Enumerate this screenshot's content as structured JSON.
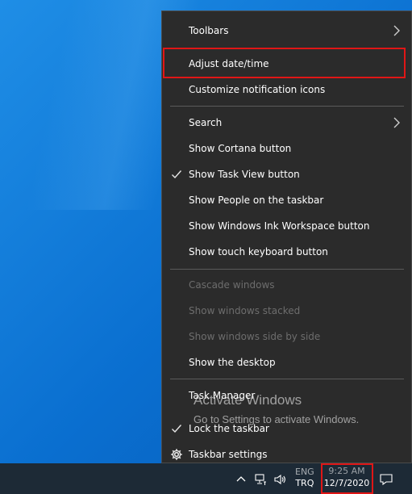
{
  "menu": {
    "items": [
      {
        "label": "Toolbars",
        "submenu": true,
        "checked": false,
        "disabled": false
      },
      {
        "label": "Adjust date/time",
        "submenu": false,
        "checked": false,
        "disabled": false
      },
      {
        "label": "Customize notification icons",
        "submenu": false,
        "checked": false,
        "disabled": false
      },
      {
        "label": "Search",
        "submenu": true,
        "checked": false,
        "disabled": false
      },
      {
        "label": "Show Cortana button",
        "submenu": false,
        "checked": false,
        "disabled": false
      },
      {
        "label": "Show Task View button",
        "submenu": false,
        "checked": true,
        "disabled": false
      },
      {
        "label": "Show People on the taskbar",
        "submenu": false,
        "checked": false,
        "disabled": false
      },
      {
        "label": "Show Windows Ink Workspace button",
        "submenu": false,
        "checked": false,
        "disabled": false
      },
      {
        "label": "Show touch keyboard button",
        "submenu": false,
        "checked": false,
        "disabled": false
      },
      {
        "label": "Cascade windows",
        "submenu": false,
        "checked": false,
        "disabled": true
      },
      {
        "label": "Show windows stacked",
        "submenu": false,
        "checked": false,
        "disabled": true
      },
      {
        "label": "Show windows side by side",
        "submenu": false,
        "checked": false,
        "disabled": true
      },
      {
        "label": "Show the desktop",
        "submenu": false,
        "checked": false,
        "disabled": false
      },
      {
        "label": "Task Manager",
        "submenu": false,
        "checked": false,
        "disabled": false
      },
      {
        "label": "Lock the taskbar",
        "submenu": false,
        "checked": true,
        "disabled": false
      },
      {
        "label": "Taskbar settings",
        "submenu": false,
        "checked": false,
        "disabled": false,
        "icon": "gear-icon"
      }
    ]
  },
  "watermark": {
    "title": "Activate Windows",
    "subtitle": "Go to Settings to activate Windows."
  },
  "taskbar": {
    "lang_top": "ENG",
    "lang_bottom": "TRQ",
    "time": "9:25 AM",
    "date": "12/7/2020",
    "tray_icons": [
      "chevron-up-icon",
      "network-icon",
      "volume-icon",
      "notification-icon"
    ]
  },
  "colors": {
    "menu_bg": "#2b2b2b",
    "menu_text": "#ffffff",
    "disabled_text": "#6d6d6d",
    "highlight_box": "#e01616",
    "taskbar_bg": "#1d2a36"
  }
}
